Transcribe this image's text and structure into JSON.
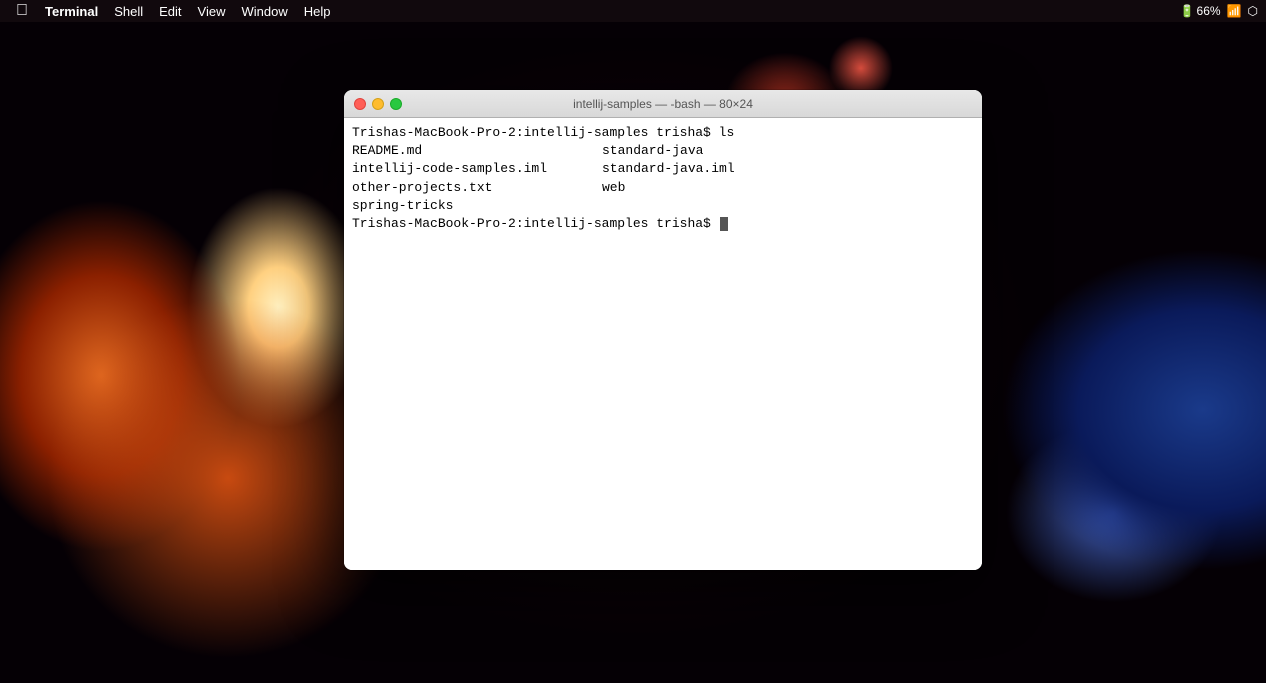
{
  "desktop": {
    "background": "cosmic dark"
  },
  "menubar": {
    "apple": "⌘",
    "app_name": "Terminal",
    "items": [
      "Shell",
      "Edit",
      "View",
      "Window",
      "Help"
    ],
    "right_items": {
      "battery": "66%",
      "wifi": "WiFi",
      "time": ""
    }
  },
  "terminal": {
    "title": "intellij-samples — -bash — 80×24",
    "content": {
      "prompt1": "Trishas-MacBook-Pro-2:intellij-samples trisha$ ls",
      "files_col1": [
        "README.md",
        "intellij-code-samples.iml",
        "other-projects.txt",
        "spring-tricks"
      ],
      "files_col2": [
        "standard-java",
        "standard-java.iml",
        "web"
      ],
      "prompt2": "Trishas-MacBook-Pro-2:intellij-samples trisha$ "
    }
  }
}
